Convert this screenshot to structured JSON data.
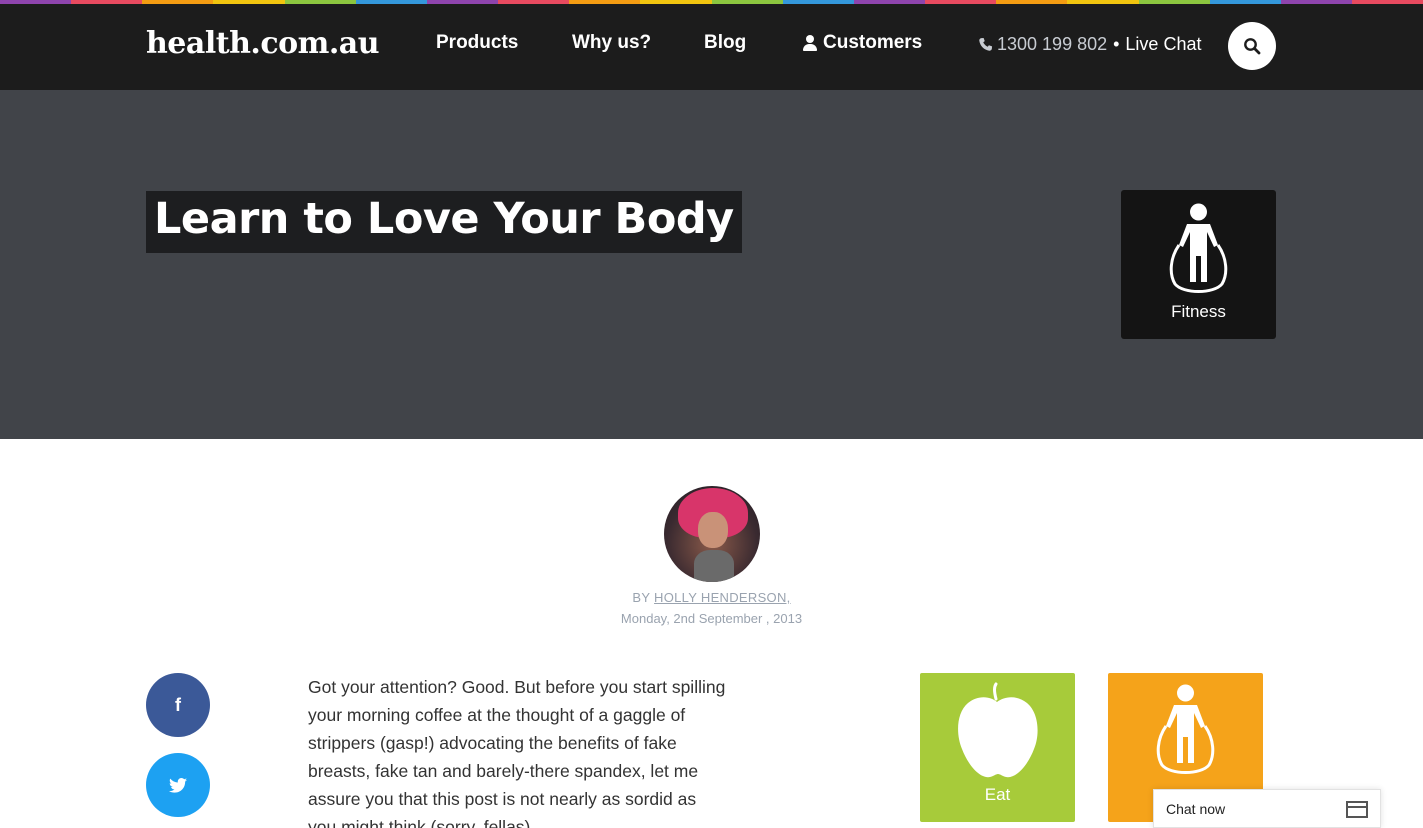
{
  "rainbow_colors": [
    "#8e44ad",
    "#e84a5f",
    "#f39c12",
    "#f1c40f",
    "#8cc63f",
    "#3498db",
    "#8e44ad",
    "#e84a5f",
    "#f39c12",
    "#f1c40f",
    "#8cc63f",
    "#3498db",
    "#8e44ad",
    "#e84a5f",
    "#f39c12",
    "#f1c40f",
    "#8cc63f",
    "#3498db",
    "#8e44ad",
    "#e84a5f"
  ],
  "header": {
    "logo": "health.com.au",
    "nav": [
      {
        "label": "Products"
      },
      {
        "label": "Why us?"
      },
      {
        "label": "Blog"
      },
      {
        "label": "Customers",
        "icon": "user-icon"
      }
    ],
    "phone_icon": "phone-icon",
    "phone": "1300 199 802",
    "separator": "•",
    "live_chat": "Live Chat",
    "search_icon": "search-icon"
  },
  "hero": {
    "title": "Learn to Love Your Body",
    "category": {
      "label": "Fitness",
      "icon": "jump-rope-icon"
    }
  },
  "author": {
    "by": "BY",
    "name": "HOLLY HENDERSON,",
    "date": "Monday, 2nd September , 2013"
  },
  "social": {
    "facebook": "f",
    "twitter_icon": "twitter-bird-icon"
  },
  "article": {
    "body": "Got your attention? Good. But before you start spilling your morning coffee at the thought of a gaggle of strippers (gasp!) advocating the benefits of fake breasts, fake tan and barely-there spandex, let me assure you that this post is not nearly as sordid as you might think (sorry, fellas)."
  },
  "tiles": [
    {
      "label": "Eat",
      "icon": "apple-icon",
      "color": "#a7cb3a"
    },
    {
      "label": "",
      "icon": "jump-rope-icon",
      "color": "#f5a31a"
    }
  ],
  "chat": {
    "label": "Chat now",
    "icon": "window-icon"
  }
}
